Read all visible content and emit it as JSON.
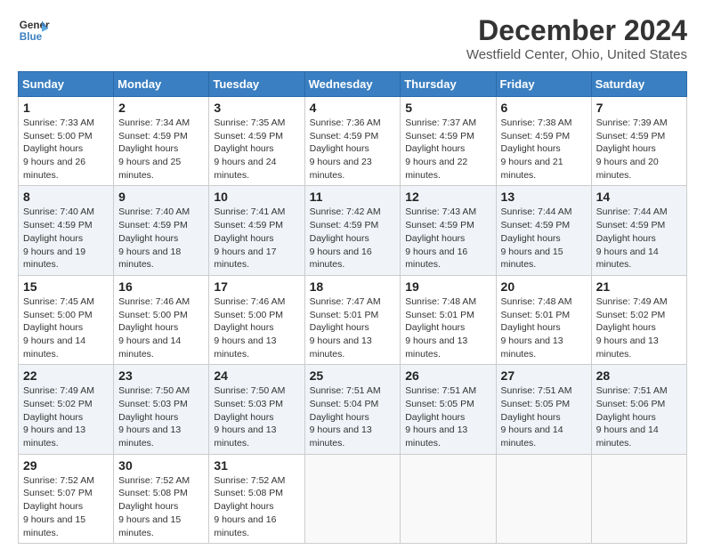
{
  "header": {
    "logo_line1": "General",
    "logo_line2": "Blue",
    "month": "December 2024",
    "location": "Westfield Center, Ohio, United States"
  },
  "weekdays": [
    "Sunday",
    "Monday",
    "Tuesday",
    "Wednesday",
    "Thursday",
    "Friday",
    "Saturday"
  ],
  "weeks": [
    [
      {
        "day": "1",
        "sunrise": "7:33 AM",
        "sunset": "5:00 PM",
        "daylight": "9 hours and 26 minutes."
      },
      {
        "day": "2",
        "sunrise": "7:34 AM",
        "sunset": "4:59 PM",
        "daylight": "9 hours and 25 minutes."
      },
      {
        "day": "3",
        "sunrise": "7:35 AM",
        "sunset": "4:59 PM",
        "daylight": "9 hours and 24 minutes."
      },
      {
        "day": "4",
        "sunrise": "7:36 AM",
        "sunset": "4:59 PM",
        "daylight": "9 hours and 23 minutes."
      },
      {
        "day": "5",
        "sunrise": "7:37 AM",
        "sunset": "4:59 PM",
        "daylight": "9 hours and 22 minutes."
      },
      {
        "day": "6",
        "sunrise": "7:38 AM",
        "sunset": "4:59 PM",
        "daylight": "9 hours and 21 minutes."
      },
      {
        "day": "7",
        "sunrise": "7:39 AM",
        "sunset": "4:59 PM",
        "daylight": "9 hours and 20 minutes."
      }
    ],
    [
      {
        "day": "8",
        "sunrise": "7:40 AM",
        "sunset": "4:59 PM",
        "daylight": "9 hours and 19 minutes."
      },
      {
        "day": "9",
        "sunrise": "7:40 AM",
        "sunset": "4:59 PM",
        "daylight": "9 hours and 18 minutes."
      },
      {
        "day": "10",
        "sunrise": "7:41 AM",
        "sunset": "4:59 PM",
        "daylight": "9 hours and 17 minutes."
      },
      {
        "day": "11",
        "sunrise": "7:42 AM",
        "sunset": "4:59 PM",
        "daylight": "9 hours and 16 minutes."
      },
      {
        "day": "12",
        "sunrise": "7:43 AM",
        "sunset": "4:59 PM",
        "daylight": "9 hours and 16 minutes."
      },
      {
        "day": "13",
        "sunrise": "7:44 AM",
        "sunset": "4:59 PM",
        "daylight": "9 hours and 15 minutes."
      },
      {
        "day": "14",
        "sunrise": "7:44 AM",
        "sunset": "4:59 PM",
        "daylight": "9 hours and 14 minutes."
      }
    ],
    [
      {
        "day": "15",
        "sunrise": "7:45 AM",
        "sunset": "5:00 PM",
        "daylight": "9 hours and 14 minutes."
      },
      {
        "day": "16",
        "sunrise": "7:46 AM",
        "sunset": "5:00 PM",
        "daylight": "9 hours and 14 minutes."
      },
      {
        "day": "17",
        "sunrise": "7:46 AM",
        "sunset": "5:00 PM",
        "daylight": "9 hours and 13 minutes."
      },
      {
        "day": "18",
        "sunrise": "7:47 AM",
        "sunset": "5:01 PM",
        "daylight": "9 hours and 13 minutes."
      },
      {
        "day": "19",
        "sunrise": "7:48 AM",
        "sunset": "5:01 PM",
        "daylight": "9 hours and 13 minutes."
      },
      {
        "day": "20",
        "sunrise": "7:48 AM",
        "sunset": "5:01 PM",
        "daylight": "9 hours and 13 minutes."
      },
      {
        "day": "21",
        "sunrise": "7:49 AM",
        "sunset": "5:02 PM",
        "daylight": "9 hours and 13 minutes."
      }
    ],
    [
      {
        "day": "22",
        "sunrise": "7:49 AM",
        "sunset": "5:02 PM",
        "daylight": "9 hours and 13 minutes."
      },
      {
        "day": "23",
        "sunrise": "7:50 AM",
        "sunset": "5:03 PM",
        "daylight": "9 hours and 13 minutes."
      },
      {
        "day": "24",
        "sunrise": "7:50 AM",
        "sunset": "5:03 PM",
        "daylight": "9 hours and 13 minutes."
      },
      {
        "day": "25",
        "sunrise": "7:51 AM",
        "sunset": "5:04 PM",
        "daylight": "9 hours and 13 minutes."
      },
      {
        "day": "26",
        "sunrise": "7:51 AM",
        "sunset": "5:05 PM",
        "daylight": "9 hours and 13 minutes."
      },
      {
        "day": "27",
        "sunrise": "7:51 AM",
        "sunset": "5:05 PM",
        "daylight": "9 hours and 14 minutes."
      },
      {
        "day": "28",
        "sunrise": "7:51 AM",
        "sunset": "5:06 PM",
        "daylight": "9 hours and 14 minutes."
      }
    ],
    [
      {
        "day": "29",
        "sunrise": "7:52 AM",
        "sunset": "5:07 PM",
        "daylight": "9 hours and 15 minutes."
      },
      {
        "day": "30",
        "sunrise": "7:52 AM",
        "sunset": "5:08 PM",
        "daylight": "9 hours and 15 minutes."
      },
      {
        "day": "31",
        "sunrise": "7:52 AM",
        "sunset": "5:08 PM",
        "daylight": "9 hours and 16 minutes."
      },
      null,
      null,
      null,
      null
    ]
  ],
  "labels": {
    "sunrise": "Sunrise:",
    "sunset": "Sunset:",
    "daylight": "Daylight hours"
  }
}
